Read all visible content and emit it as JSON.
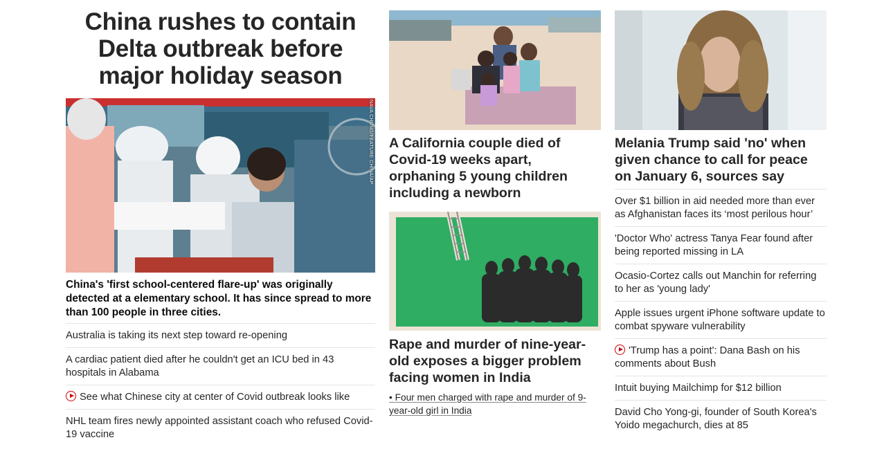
{
  "lead": {
    "headline": "China rushes to contain Delta outbreak before major holiday season",
    "image_alt": "Health workers in protective gear conducting Covid-19 tests",
    "image_credit": "NAVA CHUNG/FEATURE CHINA/AP",
    "caption": "China's 'first school-centered flare-up' was originally detected at a elementary school. It has since spread to more than 100 people in three cities.",
    "related": [
      {
        "text": "Australia is taking its next step toward re-opening",
        "video": false
      },
      {
        "text": "A cardiac patient died after he couldn't get an ICU bed in 43 hospitals in Alabama",
        "video": false
      },
      {
        "text": "See what Chinese city at center of Covid outbreak looks like",
        "video": true
      },
      {
        "text": "NHL team fires newly appointed assistant coach who refused Covid-19 vaccine",
        "video": false
      }
    ]
  },
  "middle": {
    "story1": {
      "headline": "A California couple died of Covid-19 weeks apart, orphaning 5 young children including a newborn",
      "image_alt": "Family photo on a beach"
    },
    "story2": {
      "headline": "Rape and murder of nine-year-old exposes a bigger problem facing women in India",
      "image_alt": "Illustration of silhouetted women and a ladder on green background",
      "sub_link": "• Four men charged with rape and murder of 9-year-old girl in India"
    }
  },
  "right": {
    "headline": "Melania Trump said 'no' when given chance to call for peace on January 6, sources say",
    "image_alt": "Melania Trump portrait",
    "list": [
      {
        "text": "Over $1 billion in aid needed more than ever as Afghanistan faces its ‘most perilous hour’",
        "video": false
      },
      {
        "text": "'Doctor Who' actress Tanya Fear found after being reported missing in LA",
        "video": false
      },
      {
        "text": "Ocasio-Cortez calls out Manchin for referring to her as 'young lady'",
        "video": false
      },
      {
        "text": "Apple issues urgent iPhone software update to combat spyware vulnerability",
        "video": false
      },
      {
        "text": "'Trump has a point': Dana Bash on his comments about Bush",
        "video": true
      },
      {
        "text": "Intuit buying Mailchimp for $12 billion",
        "video": false
      },
      {
        "text": "David Cho Yong-gi, founder of South Korea's Yoido megachurch, dies at 85",
        "video": false
      }
    ]
  },
  "colors": {
    "text": "#262626",
    "divider": "#e4e4e4",
    "video_red": "#cc0000"
  },
  "icons": {
    "video": "play-circle-icon"
  }
}
